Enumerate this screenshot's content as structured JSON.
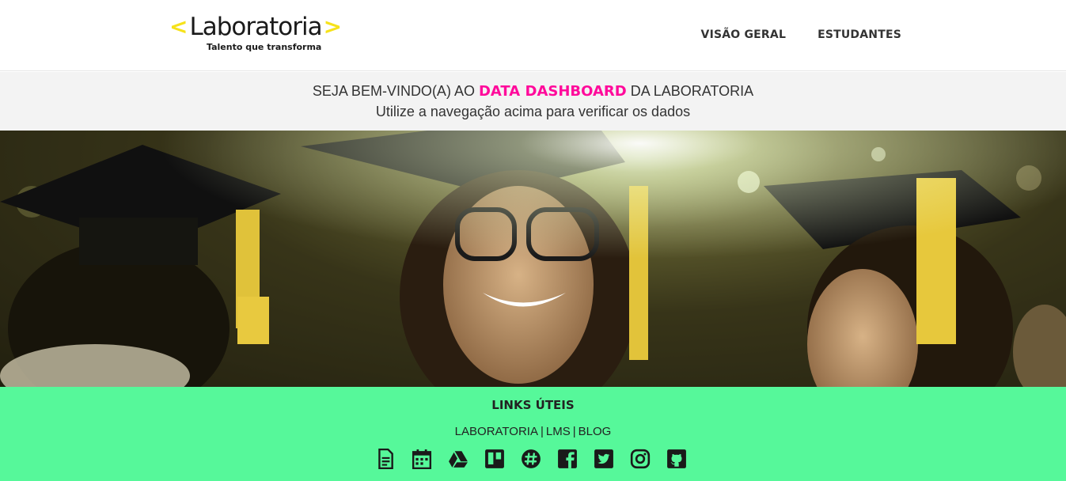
{
  "logo": {
    "bracket_left": "<",
    "name": "Laboratoria",
    "bracket_right": ">",
    "tagline": "Talento que transforma"
  },
  "nav": {
    "items": [
      {
        "label": "VISÃO GERAL"
      },
      {
        "label": "ESTUDANTES"
      }
    ]
  },
  "welcome": {
    "prefix": "SEJA BEM-VINDO(A) AO ",
    "highlight": "DATA DASHBOARD",
    "suffix": " DA LABORATORIA",
    "subtitle": "Utilize a navegação acima para verificar os dados"
  },
  "hero": {
    "image": "graduation photo with students in caps"
  },
  "footer": {
    "title": "LINKS ÚTEIS",
    "links": [
      {
        "label": "LABORATORIA"
      },
      {
        "label": "LMS"
      },
      {
        "label": "BLOG"
      }
    ],
    "separator": "|",
    "icons": [
      "document-icon",
      "calendar-icon",
      "google-drive-icon",
      "trello-icon",
      "slack-icon",
      "facebook-icon",
      "twitter-icon",
      "instagram-icon",
      "github-icon"
    ]
  },
  "colors": {
    "accent_pink": "#ff0a9b",
    "logo_yellow": "#f6e21a",
    "footer_green": "#56f89a",
    "welcome_bg": "#f3f3f3"
  }
}
